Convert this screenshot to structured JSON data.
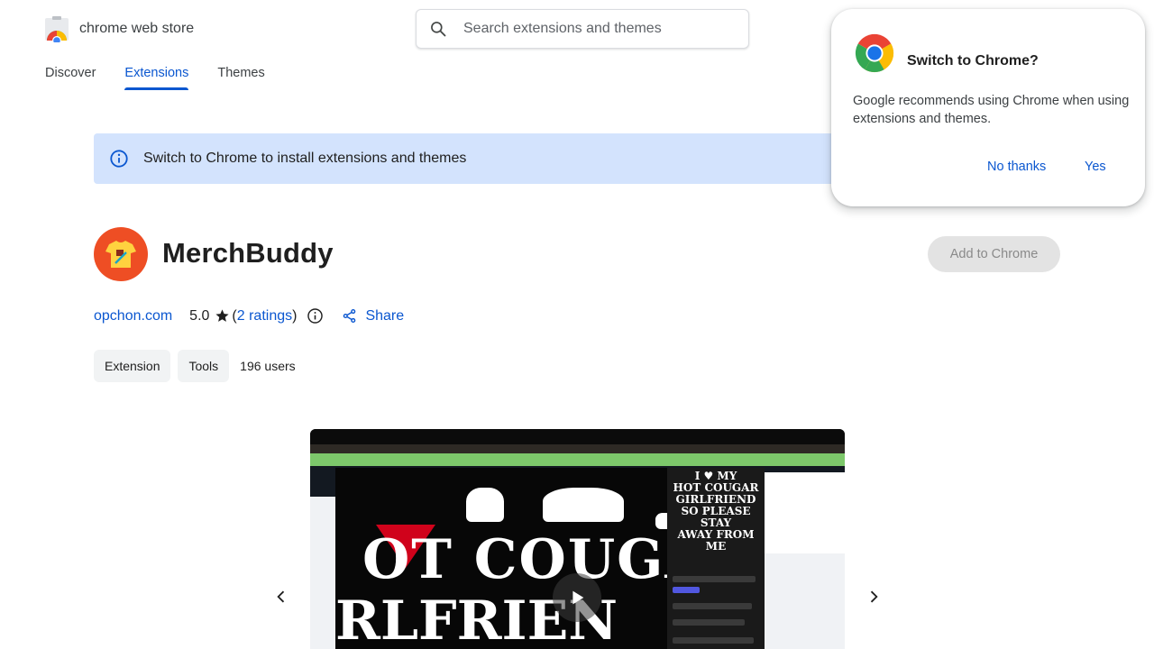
{
  "store": {
    "name": "chrome web store"
  },
  "search": {
    "placeholder": "Search extensions and themes"
  },
  "nav": {
    "tabs": [
      {
        "label": "Discover"
      },
      {
        "label": "Extensions",
        "active": true
      },
      {
        "label": "Themes"
      }
    ]
  },
  "banner": {
    "text": "Switch to Chrome to install extensions and themes"
  },
  "extension": {
    "title": "MerchBuddy",
    "add_button": "Add to Chrome",
    "developer": "opchon.com",
    "rating_value": "5.0",
    "rating_open": "(",
    "ratings_link": "2 ratings",
    "rating_close": ")",
    "share_label": "Share",
    "chips": [
      "Extension",
      "Tools"
    ],
    "users": "196 users"
  },
  "media": {
    "heart_lines": [
      "I ♥ MY",
      "HOT COUGAR",
      "GIRLFRIEND",
      "SO PLEASE STAY",
      "AWAY FROM ME"
    ],
    "big_text_1": "OT COUGA",
    "big_text_2": "RLFRIEN"
  },
  "popup": {
    "title": "Switch to Chrome?",
    "body": "Google recommends using Chrome when using extensions and themes.",
    "no_button": "No thanks",
    "yes_button": "Yes"
  },
  "colors": {
    "accent": "#0b57d0",
    "banner_bg": "#d3e3fd",
    "ext_icon_bg": "#ee4e24"
  },
  "icons": [
    "search-icon",
    "info-icon",
    "star-icon",
    "share-icon",
    "chevron-left-icon",
    "chevron-right-icon",
    "play-icon",
    "chrome-logo-icon"
  ]
}
